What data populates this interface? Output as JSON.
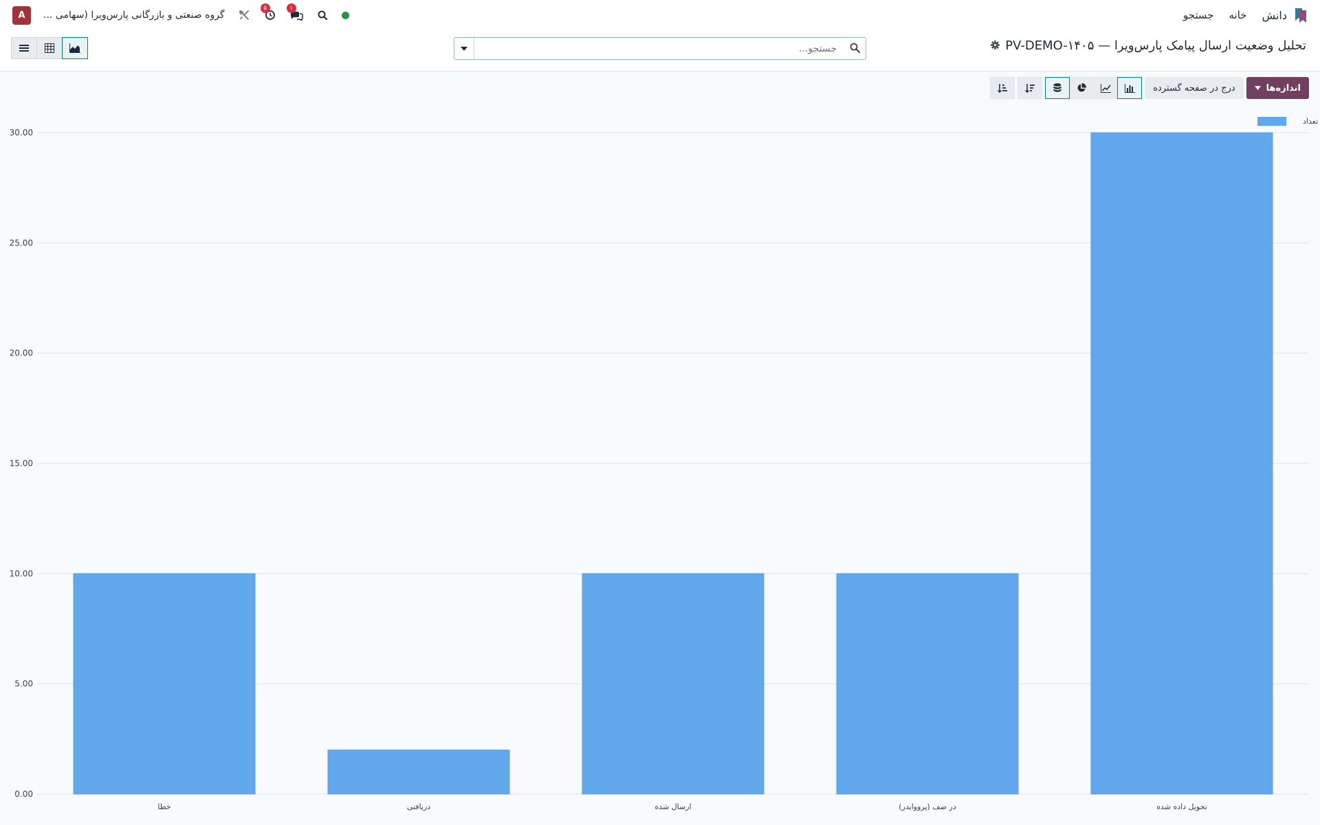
{
  "navbar": {
    "avatar_letter": "A",
    "company": "گروه صنعتی و بازرگانی پارس‌ویرا (سهامی ...",
    "activity_badge": "۵",
    "messages_badge": "۱",
    "menu": [
      "دانش",
      "خانه",
      "جستجو"
    ]
  },
  "control_panel": {
    "title": "تحلیل وضعیت ارسال پیامک پارس‌ویرا — PV-DEMO-۱۴۰۵",
    "search_placeholder": "جستجو...",
    "views": [
      "list",
      "pivot",
      "graph"
    ],
    "active_view": "graph"
  },
  "toolbar": {
    "measures_label": "اندازه‌ها",
    "spreadsheet_label": "درج در صفحه گسترده",
    "active_chart": "bar",
    "stacked_active": true
  },
  "colors": {
    "bar": "#60a7ec",
    "accent": "#71405f",
    "active_border": "#017e84"
  },
  "chart_data": {
    "type": "bar",
    "categories": [
      "تحویل داده شده",
      "در صف (پرووایدر)",
      "ارسال شده",
      "دریافتی",
      "خطا"
    ],
    "series": [
      {
        "name": "تعداد",
        "values": [
          30,
          10,
          10,
          2,
          10
        ]
      }
    ],
    "ylim": [
      0,
      30
    ],
    "yticks": [
      "0.00",
      "5.00",
      "10.00",
      "15.00",
      "20.00",
      "25.00",
      "30.00"
    ],
    "grid": true,
    "legend_position": "top-right"
  }
}
